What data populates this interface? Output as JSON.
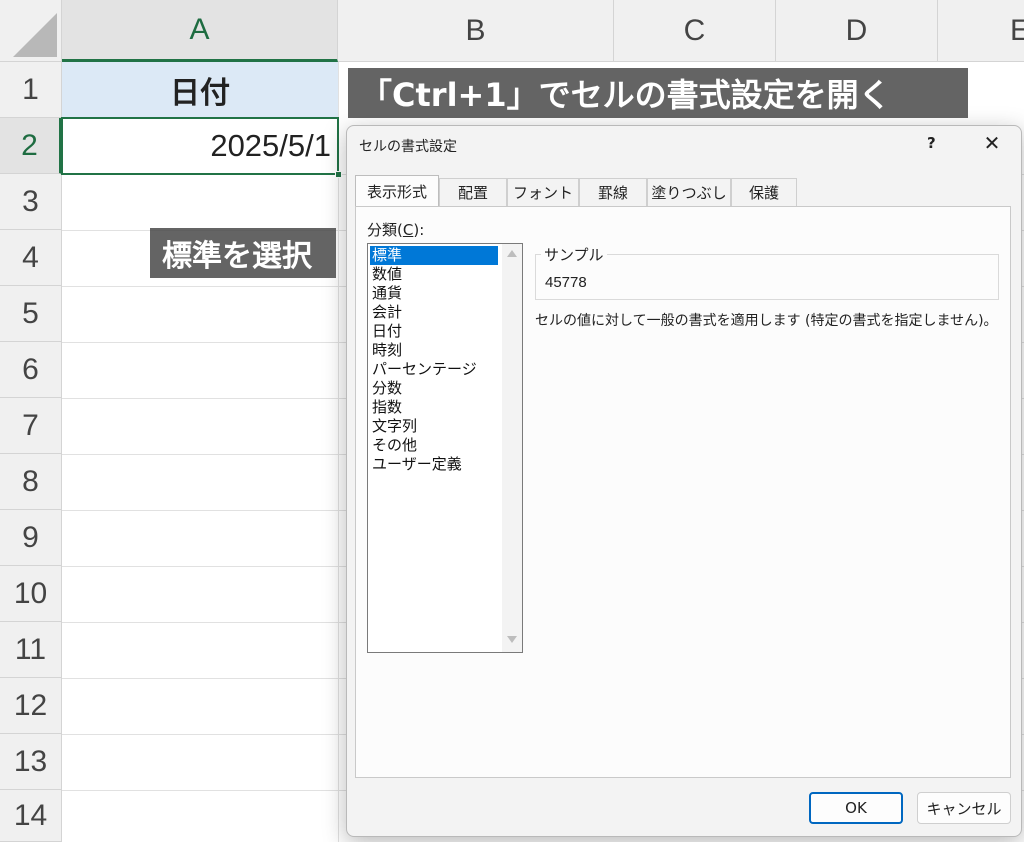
{
  "sheet": {
    "columns": [
      "A",
      "B",
      "C",
      "D",
      "E"
    ],
    "rows": [
      "1",
      "2",
      "3",
      "4",
      "5",
      "6",
      "7",
      "8",
      "9",
      "10",
      "11",
      "12",
      "13",
      "14"
    ],
    "cell_a1": "日付",
    "cell_a2": "2025/5/1"
  },
  "overlays": {
    "banner_top": "「Ctrl+1」でセルの書式設定を開く",
    "banner_left": "標準を選択"
  },
  "dialog": {
    "title": "セルの書式設定",
    "help": "?",
    "close": "✕",
    "tabs": [
      "表示形式",
      "配置",
      "フォント",
      "罫線",
      "塗りつぶし",
      "保護"
    ],
    "category_label": "分類(",
    "category_key": "C",
    "category_label_end": "):",
    "categories": [
      "標準",
      "数値",
      "通貨",
      "会計",
      "日付",
      "時刻",
      "パーセンテージ",
      "分数",
      "指数",
      "文字列",
      "その他",
      "ユーザー定義"
    ],
    "selected_category": "標準",
    "sample_label": "サンプル",
    "sample_value": "45778",
    "description": "セルの値に対して一般の書式を適用します (特定の書式を指定しません)。",
    "ok": "OK",
    "cancel": "キャンセル"
  },
  "colors": {
    "accent": "#217346",
    "header_fill": "#dce9f6",
    "selection": "#0078d7",
    "ok_border": "#0067c0"
  }
}
